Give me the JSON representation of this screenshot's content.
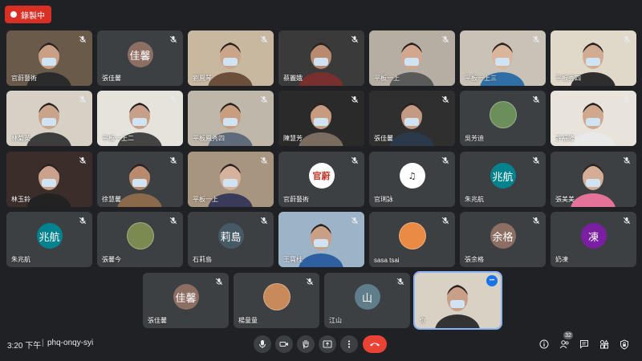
{
  "recording": {
    "label": "錄製中"
  },
  "participants": [
    {
      "name": "官蔚藝術",
      "type": "video",
      "bg": "#6a5a4a",
      "skin": "#c9a086",
      "shirt": "#2b2b2b"
    },
    {
      "name": "張佳馨",
      "type": "avatar",
      "avatar_text": "佳馨",
      "avatar_color": "#8d6e63"
    },
    {
      "name": "劉鳳琴",
      "type": "video",
      "bg": "#c8b8a0",
      "skin": "#caa58a",
      "shirt": "#6b4f3a"
    },
    {
      "name": "蔡麗娥",
      "type": "video",
      "bg": "#3a3a3a",
      "skin": "#b88a70",
      "shirt": "#7a2f2f"
    },
    {
      "name": "平板一上",
      "type": "video",
      "bg": "#b7aea3",
      "skin": "#d1a88e",
      "shirt": "#5a5a5a"
    },
    {
      "name": "平板一上三",
      "type": "video",
      "bg": "#c9c2b6",
      "skin": "#d9b59b",
      "shirt": "#2f6fa5"
    },
    {
      "name": "平板秀四",
      "type": "video",
      "bg": "#e0d8c8",
      "skin": "#d2ac92",
      "shirt": "#2e2e2e"
    },
    {
      "name": "林菊英",
      "type": "video",
      "bg": "#d7d0c5",
      "skin": "#caa48a",
      "shirt": "#3d3d3d"
    },
    {
      "name": "平板一上二",
      "type": "video",
      "bg": "#e6e2dc",
      "skin": "#c7a08a",
      "shirt": "#444"
    },
    {
      "name": "平板鳳秀四",
      "type": "video",
      "bg": "#bfb7aa",
      "skin": "#c99d80",
      "shirt": "#5f6b7a"
    },
    {
      "name": "陳慧芳",
      "type": "video",
      "bg": "#2a2a2a",
      "skin": "#c79b80",
      "shirt": "#7a6d5f"
    },
    {
      "name": "張佳馨",
      "type": "video",
      "bg": "#2f2f2f",
      "skin": "#c49b82",
      "shirt": "#2a3a4a"
    },
    {
      "name": "吳芳迪",
      "type": "image",
      "avatar_color": "#6b8e5a"
    },
    {
      "name": "許福隆",
      "type": "video",
      "bg": "#e8e4dc",
      "skin": "#d0a88e",
      "shirt": "#e9e9e9"
    },
    {
      "name": "林玉鈴",
      "type": "video",
      "bg": "#3b2e2a",
      "skin": "#caa28c",
      "shirt": "#222"
    },
    {
      "name": "徐慧馨",
      "type": "video",
      "bg": "#3c4043",
      "skin": "#b98a6c",
      "shirt": "#8a6a4a"
    },
    {
      "name": "平板一上",
      "type": "video",
      "bg": "#a8957f",
      "skin": "#d6b29c",
      "shirt": "#3a3a5a"
    },
    {
      "name": "官蔚藝術",
      "type": "logo",
      "avatar_text": "官蔚",
      "avatar_color": "#ffffff",
      "text_color": "#c0392b"
    },
    {
      "name": "官琍詠",
      "type": "logo",
      "avatar_text": "♫",
      "avatar_color": "#ffffff",
      "text_color": "#222222"
    },
    {
      "name": "朱兆航",
      "type": "avatar",
      "avatar_text": "兆航",
      "avatar_color": "#00838f"
    },
    {
      "name": "張美美",
      "type": "video",
      "bg": "#3c4043",
      "skin": "#d5ac95",
      "shirt": "#e57399"
    },
    {
      "name": "朱兆航",
      "type": "avatar",
      "avatar_text": "兆航",
      "avatar_color": "#00838f"
    },
    {
      "name": "張馨今",
      "type": "image",
      "avatar_color": "#7a8a50"
    },
    {
      "name": "石莉島",
      "type": "avatar",
      "avatar_text": "莉島",
      "avatar_color": "#455a64"
    },
    {
      "name": "王寶桂",
      "type": "video",
      "bg": "#9db4c8",
      "skin": "#c9a085",
      "shirt": "#2e5f9e"
    },
    {
      "name": "sasa tsai",
      "type": "image",
      "avatar_color": "#e98b45"
    },
    {
      "name": "張余格",
      "type": "avatar",
      "avatar_text": "余格",
      "avatar_color": "#8d6e63"
    },
    {
      "name": "奶凍",
      "type": "avatar",
      "avatar_text": "凍",
      "avatar_color": "#7b1fa2"
    },
    {
      "name": "張佳馨",
      "type": "avatar",
      "avatar_text": "佳馨",
      "avatar_color": "#8d6e63"
    },
    {
      "name": "楊童童",
      "type": "image",
      "avatar_color": "#c88a5a"
    },
    {
      "name": "江山",
      "type": "avatar",
      "avatar_text": "山",
      "avatar_color": "#607d8b"
    },
    {
      "name": "你",
      "type": "video",
      "bg": "#d9d2c4",
      "skin": "#c9a087",
      "shirt": "#333",
      "self": true
    }
  ],
  "meeting": {
    "time": "3:20 下午",
    "separator": "|",
    "code": "phq-onqy-syi"
  },
  "controls": {
    "people_count": "32",
    "colors": {
      "end_call": "#ea4335",
      "button": "#3c4043",
      "highlight": "#8ab4f8"
    }
  }
}
